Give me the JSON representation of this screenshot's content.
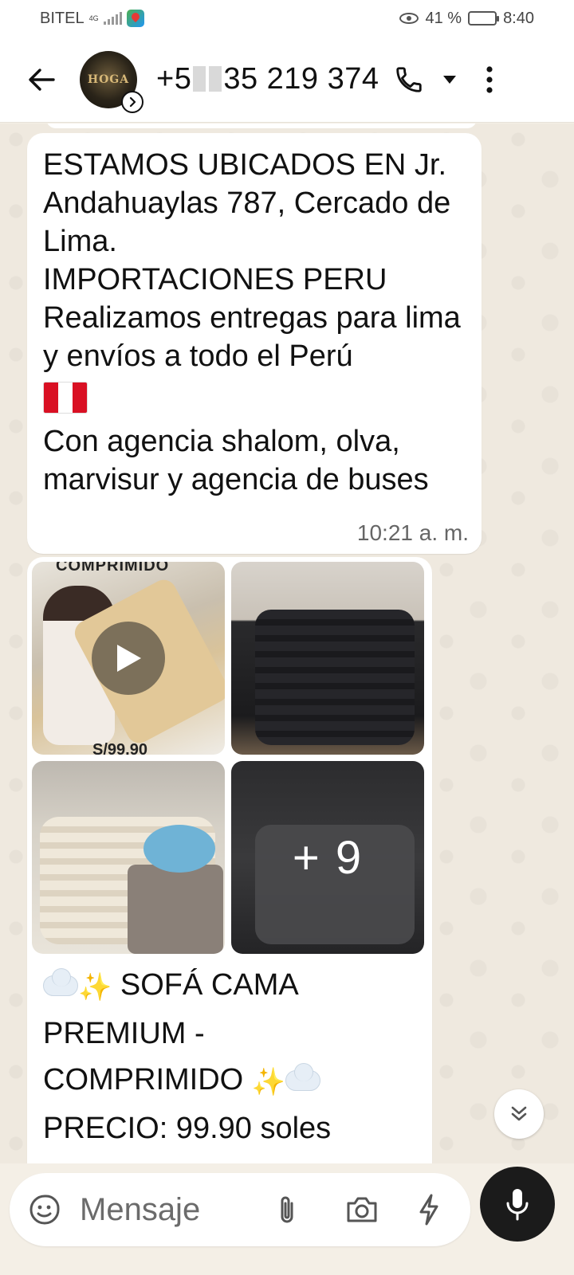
{
  "status_bar": {
    "carrier": "BITEL",
    "network": "4G",
    "battery_percent": "41 %",
    "battery_level": 0.41,
    "time": "8:40"
  },
  "header": {
    "contact_prefix": "+5",
    "contact_suffix": "35 219 374",
    "avatar_text": "HOGA"
  },
  "messages": {
    "text_1": {
      "lines_a": "ESTAMOS UBICADOS EN Jr. Andahuaylas 787, Cercado de Lima.\nIMPORTACIONES PERU\nRealizamos entregas para lima y envíos a todo el Perú",
      "lines_b": "Con agencia shalom, olva, marvisur y agencia de buses",
      "time": "10:21 a. m."
    },
    "media": {
      "video_caption_top": "COMPRIMIDO",
      "video_caption_bottom": "S/99.90",
      "more_count": "+ 9"
    },
    "caption": {
      "line_1": " SOFÁ CAMA",
      "line_2": "PREMIUM -",
      "line_3": "COMPRIMIDO ",
      "line_4": "PRECIO: 99.90 soles"
    }
  },
  "composer": {
    "placeholder": "Mensaje"
  },
  "colors": {
    "chat_bg": "#efe9df",
    "bubble": "#ffffff",
    "mic_button": "#1b1b1b"
  }
}
